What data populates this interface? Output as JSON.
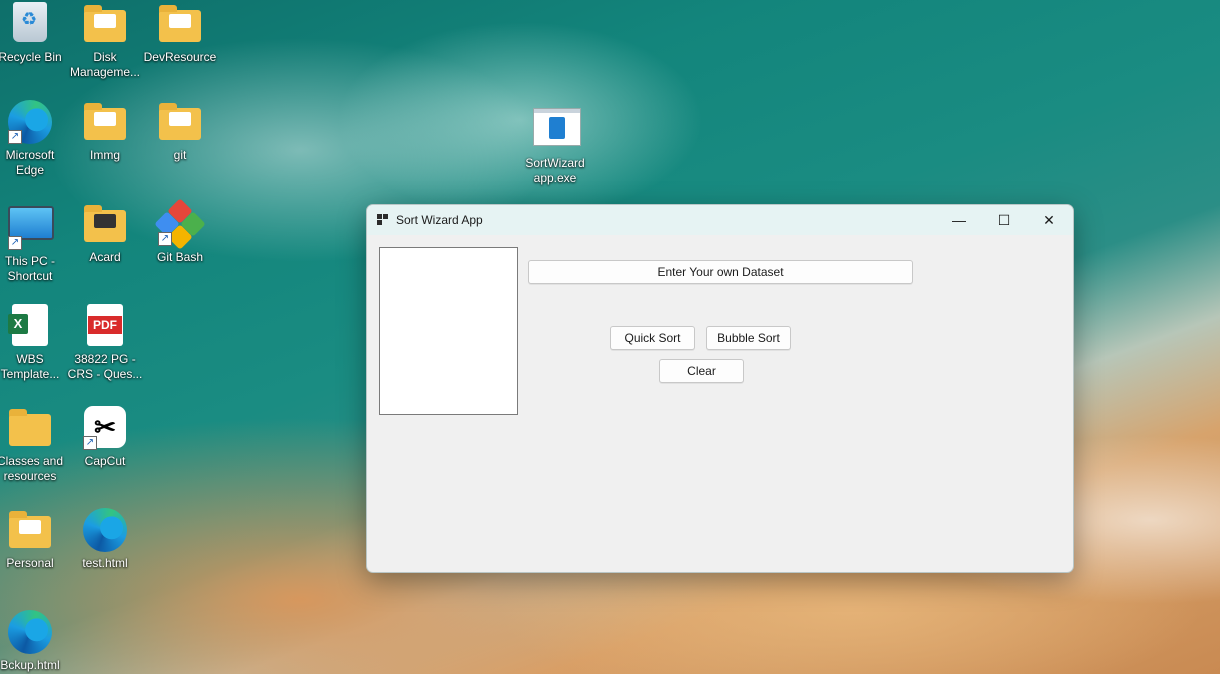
{
  "desktop": {
    "icons": [
      {
        "label": "Recycle Bin"
      },
      {
        "label": "Disk Manageme..."
      },
      {
        "label": "DevResource"
      },
      {
        "label": "Microsoft Edge"
      },
      {
        "label": "Immg"
      },
      {
        "label": "git"
      },
      {
        "label": "SortWizard app.exe"
      },
      {
        "label": "This PC - Shortcut"
      },
      {
        "label": "Acard"
      },
      {
        "label": "Git Bash"
      },
      {
        "label": "WBS Template..."
      },
      {
        "label": "38822 PG - CRS - Ques..."
      },
      {
        "label": "Classes and resources"
      },
      {
        "label": "CapCut"
      },
      {
        "label": "Personal"
      },
      {
        "label": "test.html"
      },
      {
        "label": "Bckup.html"
      }
    ]
  },
  "window": {
    "title": "Sort Wizard App",
    "controls": {
      "minimize": "—",
      "maximize": "☐",
      "close": "✕"
    },
    "buttons": {
      "enter_dataset": "Enter Your own Dataset",
      "quick_sort": "Quick Sort",
      "bubble_sort": "Bubble Sort",
      "clear": "Clear"
    },
    "pdf_badge": "PDF",
    "excel_badge": "X"
  }
}
